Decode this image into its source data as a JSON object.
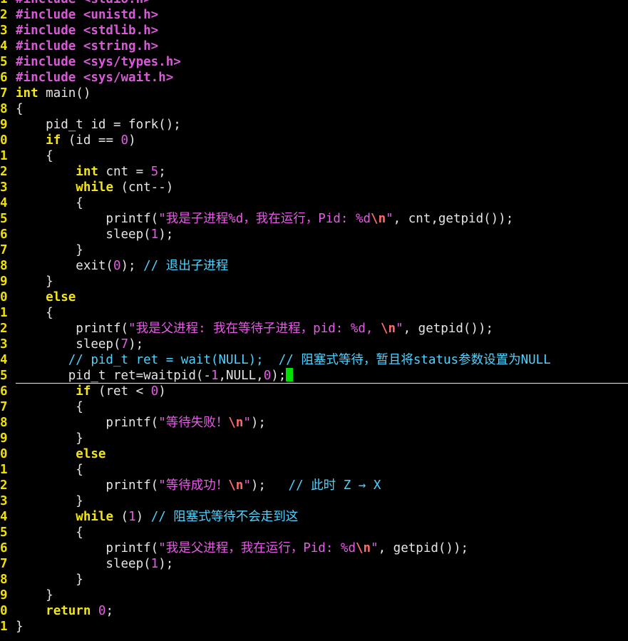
{
  "editor": {
    "cursor_line_index": 24,
    "colors": {
      "background": "#000000",
      "line_number": "#f0e000",
      "preprocessor": "#d85ad8",
      "keyword": "#f2e41a",
      "string": "#e85ae8",
      "escape": "#ff6a6a",
      "comment": "#4fd2ff",
      "text": "#e6e6e6",
      "cursor": "#00e000"
    },
    "lines": [
      {
        "n": "1",
        "t": [
          [
            "pre",
            "#include <stdio.h>"
          ]
        ]
      },
      {
        "n": "2",
        "t": [
          [
            "pre",
            "#include <unistd.h>"
          ]
        ]
      },
      {
        "n": "3",
        "t": [
          [
            "pre",
            "#include <stdlib.h>"
          ]
        ]
      },
      {
        "n": "4",
        "t": [
          [
            "pre",
            "#include <string.h>"
          ]
        ]
      },
      {
        "n": "5",
        "t": [
          [
            "pre",
            "#include <sys/types.h>"
          ]
        ]
      },
      {
        "n": "6",
        "t": [
          [
            "pre",
            "#include <sys/wait.h>"
          ]
        ]
      },
      {
        "n": "7",
        "t": [
          [
            "kw",
            "int"
          ],
          [
            "txt",
            " main()"
          ]
        ]
      },
      {
        "n": "8",
        "t": [
          [
            "txt",
            "{"
          ]
        ]
      },
      {
        "n": "9",
        "t": [
          [
            "txt",
            "    pid_t id = fork();"
          ]
        ]
      },
      {
        "n": "0",
        "t": [
          [
            "txt",
            "    "
          ],
          [
            "kw",
            "if"
          ],
          [
            "txt",
            " (id == "
          ],
          [
            "num",
            "0"
          ],
          [
            "txt",
            ")"
          ]
        ]
      },
      {
        "n": "1",
        "t": [
          [
            "txt",
            "    {"
          ]
        ]
      },
      {
        "n": "2",
        "t": [
          [
            "txt",
            "        "
          ],
          [
            "kw",
            "int"
          ],
          [
            "txt",
            " cnt = "
          ],
          [
            "num",
            "5"
          ],
          [
            "txt",
            ";"
          ]
        ]
      },
      {
        "n": "3",
        "t": [
          [
            "txt",
            "        "
          ],
          [
            "kw",
            "while"
          ],
          [
            "txt",
            " (cnt--)"
          ]
        ]
      },
      {
        "n": "4",
        "t": [
          [
            "txt",
            "        {"
          ]
        ]
      },
      {
        "n": "5",
        "t": [
          [
            "txt",
            "            printf("
          ],
          [
            "str",
            "\"我是子进程%d，我在运行，Pid: %d"
          ],
          [
            "esc",
            "\\n"
          ],
          [
            "str",
            "\""
          ],
          [
            "txt",
            ", cnt,getpid());"
          ]
        ]
      },
      {
        "n": "6",
        "t": [
          [
            "txt",
            "            sleep("
          ],
          [
            "num",
            "1"
          ],
          [
            "txt",
            ");"
          ]
        ]
      },
      {
        "n": "7",
        "t": [
          [
            "txt",
            "        }"
          ]
        ]
      },
      {
        "n": "8",
        "t": [
          [
            "txt",
            "        exit("
          ],
          [
            "num",
            "0"
          ],
          [
            "txt",
            "); "
          ],
          [
            "cmt",
            "// 退出子进程"
          ]
        ]
      },
      {
        "n": "9",
        "t": [
          [
            "txt",
            "    }"
          ]
        ]
      },
      {
        "n": "0",
        "t": [
          [
            "txt",
            "    "
          ],
          [
            "kw",
            "else"
          ]
        ]
      },
      {
        "n": "1",
        "t": [
          [
            "txt",
            "    {"
          ]
        ]
      },
      {
        "n": "2",
        "t": [
          [
            "txt",
            "        printf("
          ],
          [
            "str",
            "\"我是父进程: 我在等待子进程，pid: %d, "
          ],
          [
            "esc",
            "\\n"
          ],
          [
            "str",
            "\""
          ],
          [
            "txt",
            ", getpid());"
          ]
        ]
      },
      {
        "n": "3",
        "t": [
          [
            "txt",
            "        sleep("
          ],
          [
            "num",
            "7"
          ],
          [
            "txt",
            ");"
          ]
        ]
      },
      {
        "n": "4",
        "t": [
          [
            "cmt",
            "       // pid_t ret = wait(NULL);  // 阻塞式等待，暂且将status参数设置为NULL"
          ]
        ]
      },
      {
        "n": "5",
        "t": [
          [
            "txt",
            "       pid_t ret=waitpid(-"
          ],
          [
            "num",
            "1"
          ],
          [
            "txt",
            ",NULL,"
          ],
          [
            "num",
            "0"
          ],
          [
            "txt",
            ");"
          ]
        ]
      },
      {
        "n": "6",
        "t": [
          [
            "txt",
            "        "
          ],
          [
            "kw",
            "if"
          ],
          [
            "txt",
            " (ret < "
          ],
          [
            "num",
            "0"
          ],
          [
            "txt",
            ")"
          ]
        ]
      },
      {
        "n": "7",
        "t": [
          [
            "txt",
            "        {"
          ]
        ]
      },
      {
        "n": "8",
        "t": [
          [
            "txt",
            "            printf("
          ],
          [
            "str",
            "\"等待失败！"
          ],
          [
            "esc",
            "\\n"
          ],
          [
            "str",
            "\""
          ],
          [
            "txt",
            ");"
          ]
        ]
      },
      {
        "n": "9",
        "t": [
          [
            "txt",
            "        }"
          ]
        ]
      },
      {
        "n": "0",
        "t": [
          [
            "txt",
            "        "
          ],
          [
            "kw",
            "else"
          ]
        ]
      },
      {
        "n": "1",
        "t": [
          [
            "txt",
            "        {"
          ]
        ]
      },
      {
        "n": "2",
        "t": [
          [
            "txt",
            "            printf("
          ],
          [
            "str",
            "\"等待成功！"
          ],
          [
            "esc",
            "\\n"
          ],
          [
            "str",
            "\""
          ],
          [
            "txt",
            ");   "
          ],
          [
            "cmt",
            "// 此时 Z → X"
          ]
        ]
      },
      {
        "n": "3",
        "t": [
          [
            "txt",
            "        }"
          ]
        ]
      },
      {
        "n": "4",
        "t": [
          [
            "txt",
            "        "
          ],
          [
            "kw",
            "while"
          ],
          [
            "txt",
            " ("
          ],
          [
            "num",
            "1"
          ],
          [
            "txt",
            ") "
          ],
          [
            "cmt",
            "// 阻塞式等待不会走到这"
          ]
        ]
      },
      {
        "n": "5",
        "t": [
          [
            "txt",
            "        {"
          ]
        ]
      },
      {
        "n": "6",
        "t": [
          [
            "txt",
            "            printf("
          ],
          [
            "str",
            "\"我是父进程，我在运行，Pid: %d"
          ],
          [
            "esc",
            "\\n"
          ],
          [
            "str",
            "\""
          ],
          [
            "txt",
            ", getpid());"
          ]
        ]
      },
      {
        "n": "7",
        "t": [
          [
            "txt",
            "            sleep("
          ],
          [
            "num",
            "1"
          ],
          [
            "txt",
            ");"
          ]
        ]
      },
      {
        "n": "8",
        "t": [
          [
            "txt",
            "        }"
          ]
        ]
      },
      {
        "n": "9",
        "t": [
          [
            "txt",
            "    }"
          ]
        ]
      },
      {
        "n": "0",
        "t": [
          [
            "txt",
            "    "
          ],
          [
            "kw",
            "return"
          ],
          [
            "txt",
            " "
          ],
          [
            "num",
            "0"
          ],
          [
            "txt",
            ";"
          ]
        ]
      },
      {
        "n": "1",
        "t": [
          [
            "txt",
            "}"
          ]
        ]
      }
    ]
  }
}
